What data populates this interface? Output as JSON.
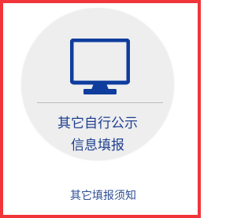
{
  "card": {
    "icon": "monitor-icon",
    "title_line1": "其它自行公示",
    "title_line2": "信息填报"
  },
  "footer": {
    "notice_label": "其它填报须知"
  },
  "colors": {
    "frame_border": "#f1353b",
    "circle_bg": "#eeeeef",
    "icon_blue": "#0f3d9e",
    "title_text": "#1e3f8f",
    "divider": "#bcbcbc"
  }
}
